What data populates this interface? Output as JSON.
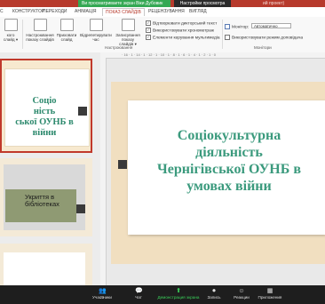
{
  "window": {
    "title_hint": "ий проект)",
    "share_banner": "Ви просматриваете экран Віки Дубовик",
    "share_settings": "Настройки просмотра"
  },
  "tabs": [
    {
      "label": "С"
    },
    {
      "label": "КОНСТРУКТОР"
    },
    {
      "label": "ПЕРЕХОДИ"
    },
    {
      "label": "АНІМАЦІЯ"
    },
    {
      "label": "ПОКАЗ СЛАЙДІВ"
    },
    {
      "label": "РЕЦЕНЗУВАННЯ"
    },
    {
      "label": "ВИГЛЯД"
    }
  ],
  "ribbon": {
    "buttons": [
      {
        "label": "кого\nслайд ▾"
      },
      {
        "label": "Настроювання\nпоказу слайдів"
      },
      {
        "label": "Приховати\nслайд"
      },
      {
        "label": "Відрепетирувати\nчас"
      },
      {
        "label": "Записування\nпоказу\nслайдів ▾"
      }
    ],
    "group_setup": "Настроювання",
    "checkboxes": [
      {
        "label": "Відтворювати дикторський текст",
        "checked": "✓"
      },
      {
        "label": "Використовувати хронометраж",
        "checked": "✓"
      },
      {
        "label": "Елементи керування мультимедіа",
        "checked": "✓"
      }
    ],
    "monitor_label": "Монітор:",
    "monitor_value": "Автоматично",
    "presenter_view": "Використовувати режим доповідача",
    "group_monitors": "Монітори"
  },
  "thumbnails": {
    "slide1_title": "Соціо\nність\nської ОУНБ в\nвійни",
    "slide2_title": "Укриття в\nбібліотеках"
  },
  "ruler": "· 16 · 1 · 14 · 1 · 12 · 1 · 10 · 1 · 8 · 1 · 6 · 1 · 4 · 1 · 2 · 1 · 0",
  "slide": {
    "title_lines": [
      "Соціокультурна",
      "діяльність",
      "Чернігівської ОУНБ в",
      "умовах війни"
    ]
  },
  "bottombar": {
    "participants": "Участники",
    "participants_count": "27",
    "chat": "Чат",
    "share": "Демонстрация экрана",
    "record": "Запись",
    "reactions": "Реакции",
    "apps": "Приложения"
  },
  "colors": {
    "accent": "#b73a2c",
    "title_green": "#3b9a7d",
    "share_green": "#34a853"
  }
}
